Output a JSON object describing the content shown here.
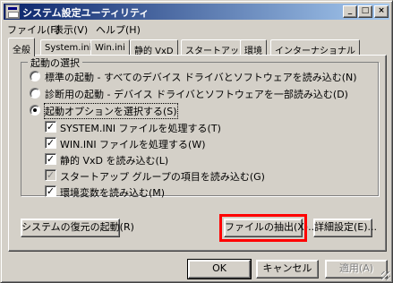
{
  "window": {
    "title": "システム設定ユーティリティ"
  },
  "menubar": {
    "file": "ファイル(F)",
    "view": "表示(V)",
    "help": "ヘルプ(H)"
  },
  "tabs": [
    {
      "label": "全般",
      "active": true
    },
    {
      "label": "System.ini"
    },
    {
      "label": "Win.ini"
    },
    {
      "label": "静的 VxD"
    },
    {
      "label": "スタートアップ"
    },
    {
      "label": "環境"
    },
    {
      "label": "インターナショナル"
    }
  ],
  "startup_group": {
    "label": "起動の選択",
    "options": [
      {
        "label": "標準の起動 - すべてのデバイス ドライバとソフトウェアを読み込む(N)",
        "selected": false
      },
      {
        "label": "診断用の起動 - デバイス ドライバとソフトウェアを一部読み込む(D)",
        "selected": false
      },
      {
        "label": "起動オプションを選択する(S)",
        "selected": true
      }
    ],
    "checkboxes": [
      {
        "label": "SYSTEM.INI ファイルを処理する(T)",
        "checked": true
      },
      {
        "label": "WIN.INI ファイルを処理する(W)",
        "checked": true
      },
      {
        "label": "静的 VxD を読み込む(L)",
        "checked": true
      },
      {
        "label": "スタートアップ グループの項目を読み込む(G)",
        "checked": true,
        "grayed": true
      },
      {
        "label": "環境変数を読み込む(M)",
        "checked": true
      }
    ]
  },
  "buttons": {
    "restore": "システムの復元の起動(R)",
    "extract": "ファイルの抽出(X)...",
    "advanced": "詳細設定(E)...",
    "ok": "OK",
    "cancel": "キャンセル",
    "apply": "適用(A)"
  },
  "icons": {
    "minimize": "_",
    "maximize": "□",
    "close": "×",
    "check": "✓"
  },
  "colors": {
    "highlight": "#ff0000",
    "titlebar_start": "#0a246a",
    "titlebar_end": "#a6caf0"
  }
}
